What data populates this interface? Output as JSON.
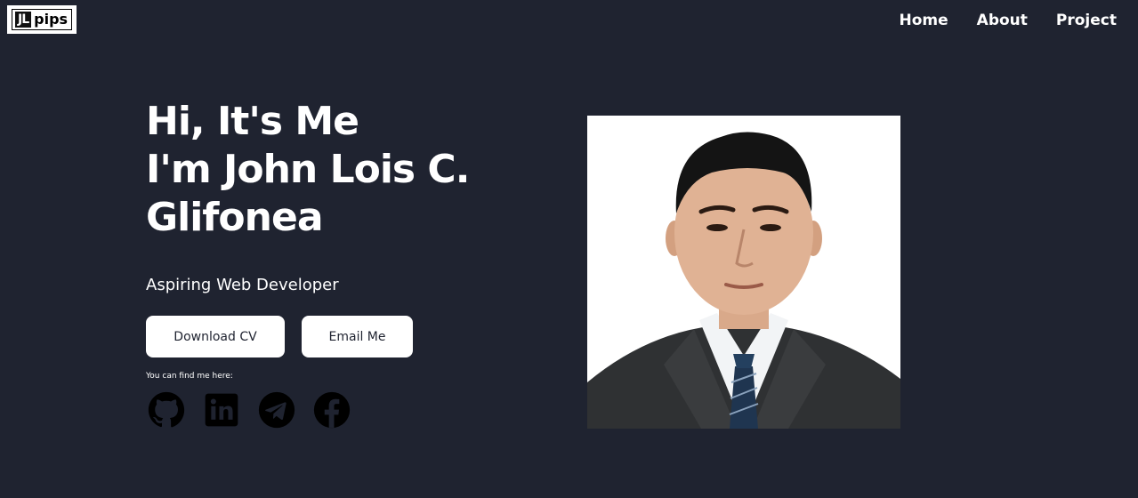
{
  "logo": {
    "box_text": "JL",
    "text": "pips"
  },
  "nav": {
    "home": "Home",
    "about": "About",
    "project": "Project"
  },
  "hero": {
    "line1": "Hi, It's Me",
    "line2": "I'm John Lois C.",
    "line3": "Glifonea",
    "subtitle": "Aspiring Web Developer"
  },
  "buttons": {
    "download_cv": "Download CV",
    "email_me": "Email Me"
  },
  "socials": {
    "label": "You can find me here:",
    "icons": [
      "github-icon",
      "linkedin-icon",
      "telegram-icon",
      "facebook-icon"
    ]
  },
  "colors": {
    "background": "#1f2330",
    "text": "#ffffff",
    "button_bg": "#ffffff",
    "icon": "#000000"
  }
}
